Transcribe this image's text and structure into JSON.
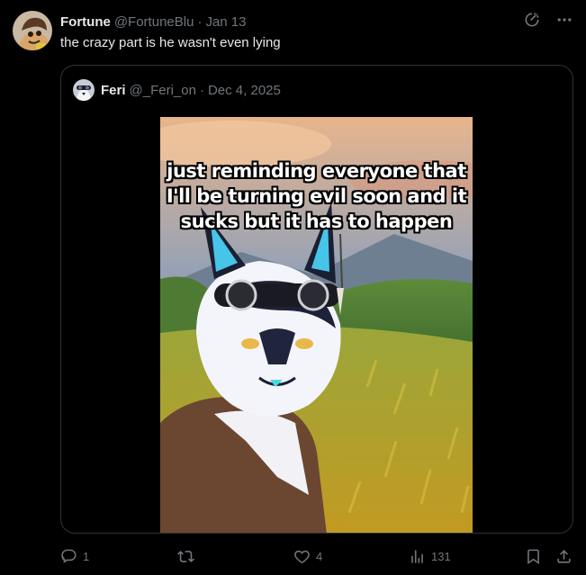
{
  "post": {
    "author_name": "Fortune",
    "author_handle": "@FortuneBlu",
    "separator": "·",
    "date": "Jan 13",
    "text": "the crazy part is he wasn't even lying"
  },
  "quoted": {
    "author_name": "Feri",
    "author_handle": "@_Feri_on",
    "separator": "·",
    "date": "Dec 4, 2025",
    "caption": "just reminding everyone that I'll be turning evil soon and it sucks but it has to happen"
  },
  "actions": {
    "replies": "1",
    "reposts": "",
    "likes": "4",
    "views": "131"
  },
  "icons": {
    "top": [
      "grok-icon",
      "more-icon"
    ],
    "actions": [
      "reply-icon",
      "repost-icon",
      "like-icon",
      "views-icon",
      "bookmark-icon",
      "share-icon"
    ]
  },
  "colors": {
    "background": "#000000",
    "text": "#e7e9ea",
    "muted": "#71767b",
    "border": "#2f3336"
  }
}
